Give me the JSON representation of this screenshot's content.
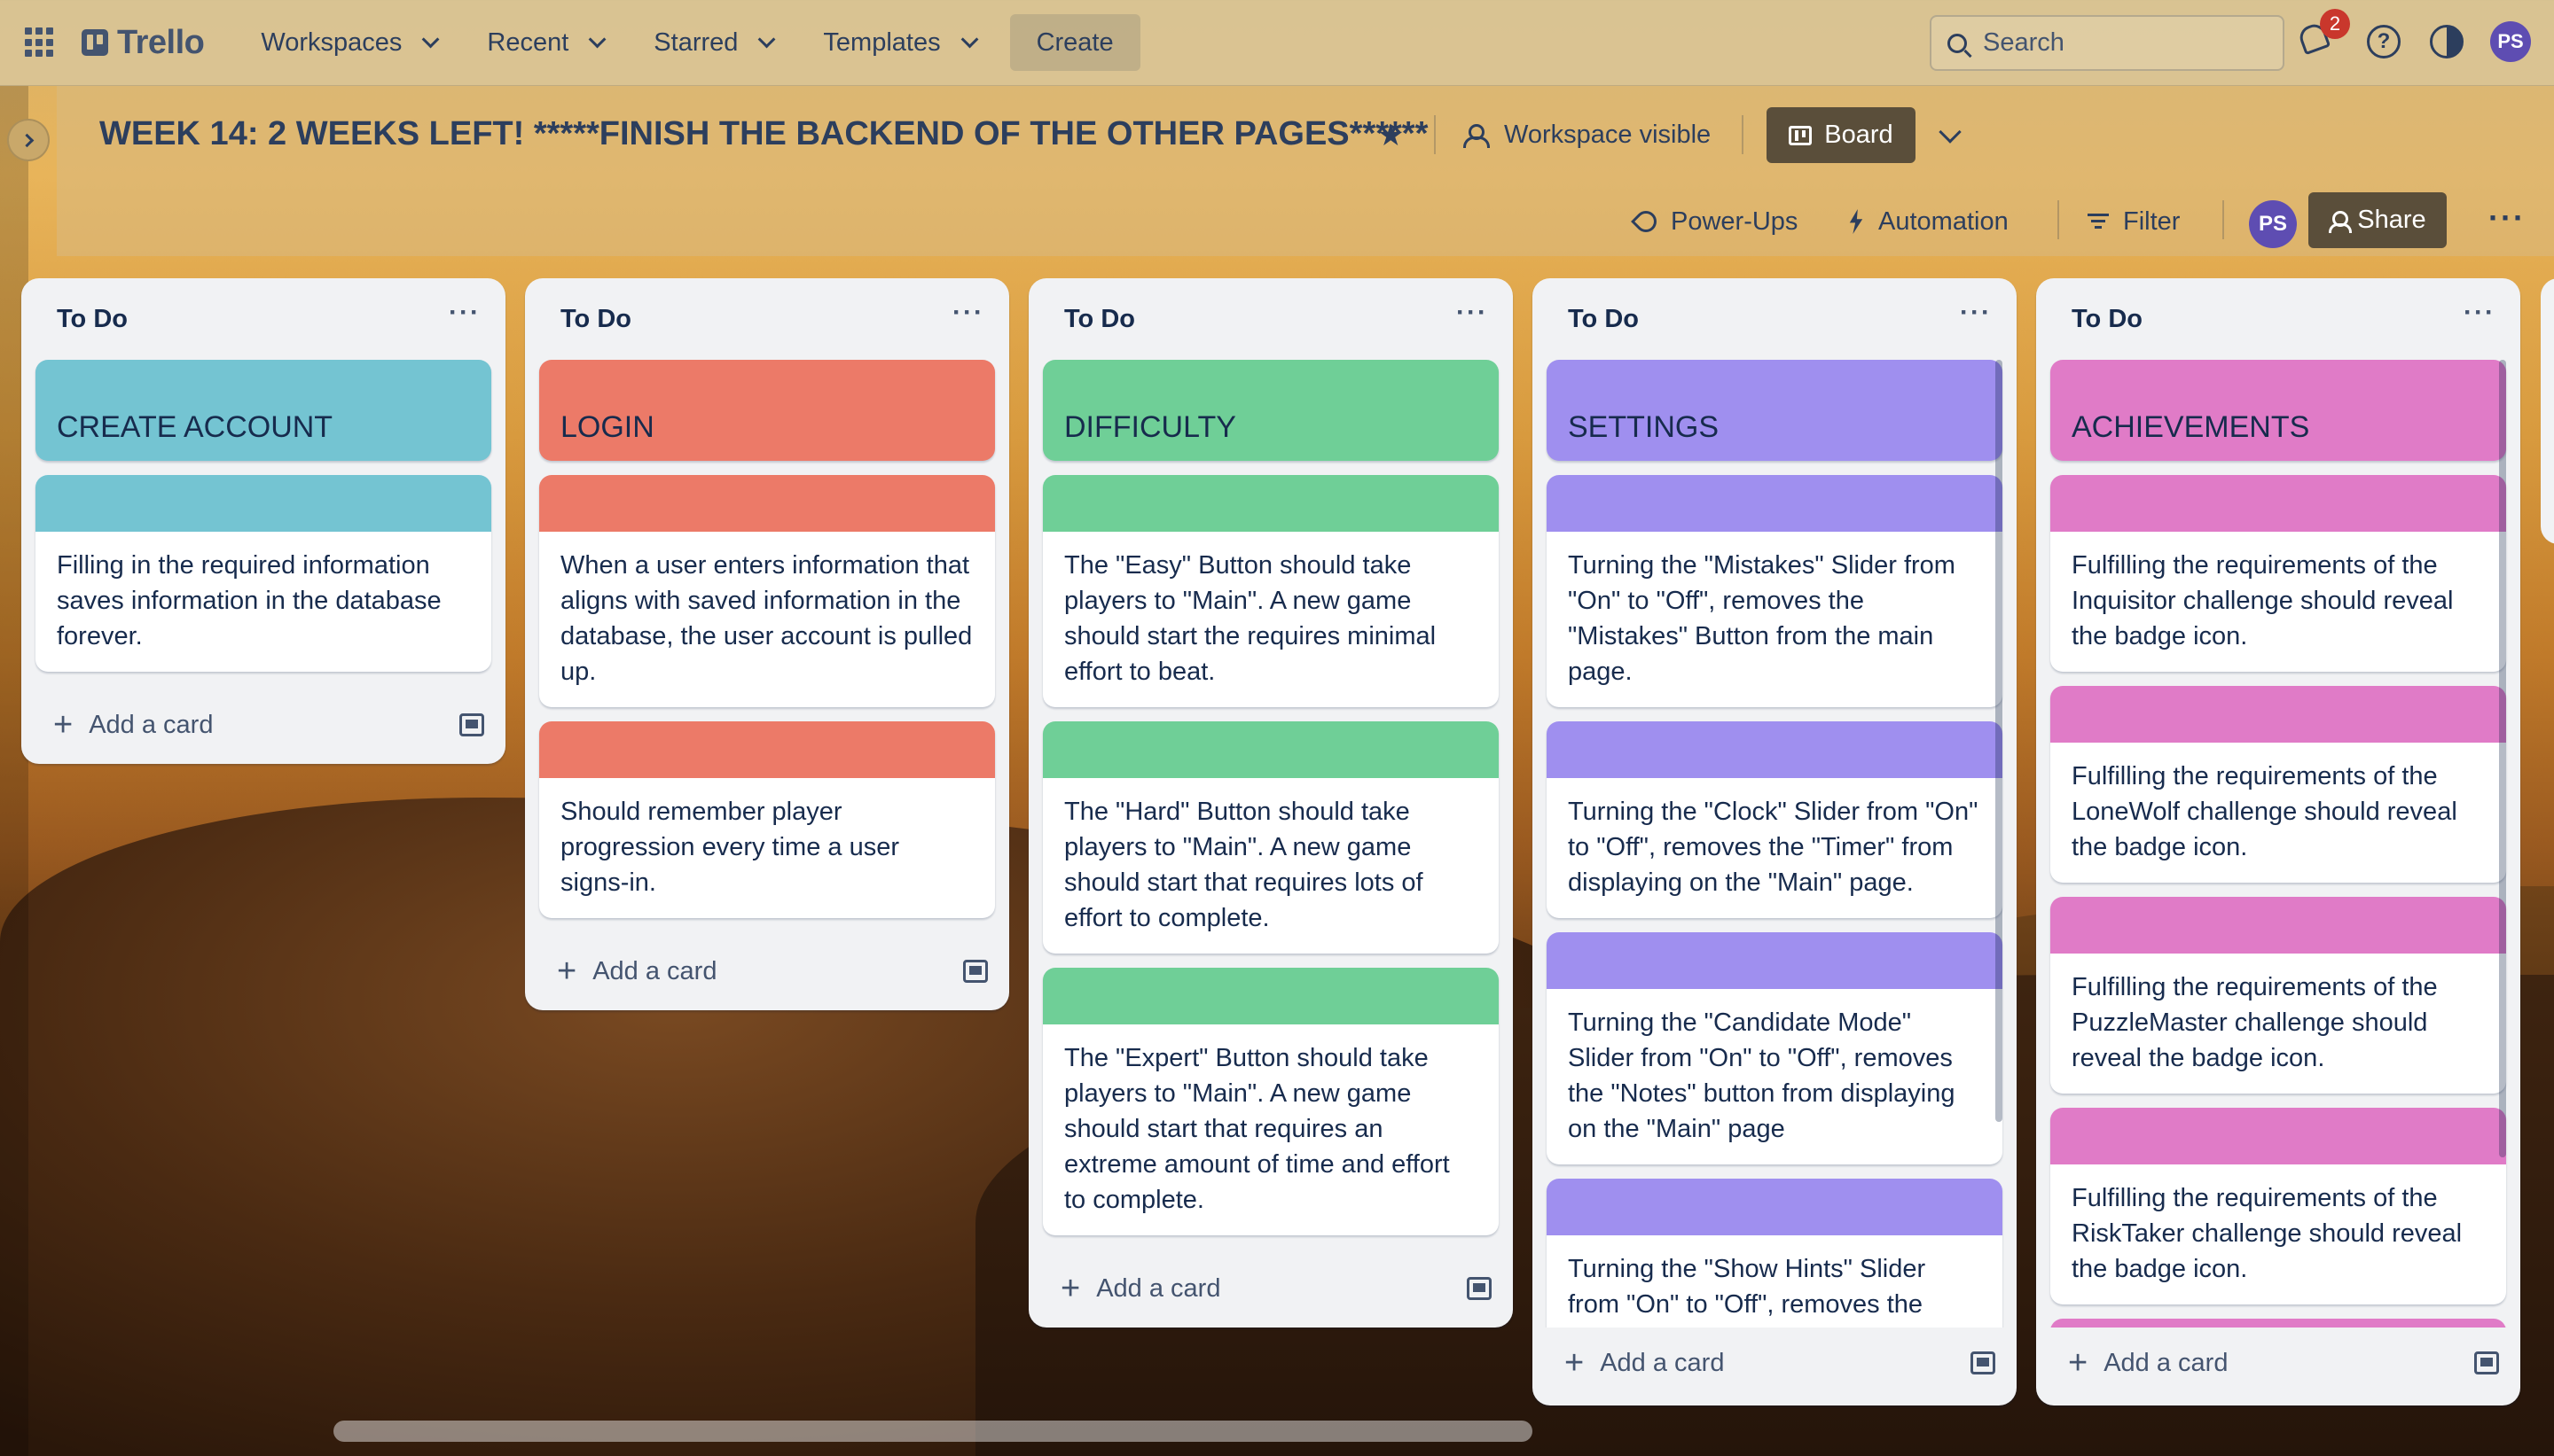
{
  "nav": {
    "logo": "Trello",
    "menus": [
      "Workspaces",
      "Recent",
      "Starred",
      "Templates"
    ],
    "create": "Create",
    "search_placeholder": "Search",
    "notifications": "2",
    "user_initials": "PS"
  },
  "board": {
    "title": "WEEK 14: 2 WEEKS LEFT! *****FINISH THE BACKEND OF THE OTHER PAGES******",
    "visibility": "Workspace visible",
    "view": "Board",
    "powerups": "Power-Ups",
    "automation": "Automation",
    "filter": "Filter",
    "share": "Share",
    "member_initials": "PS"
  },
  "colors": {
    "teal": "#74c4d2",
    "red": "#ec7a68",
    "green": "#6fcf97",
    "purple": "#9f8fef",
    "pink": "#e07bc7"
  },
  "lists": [
    {
      "title": "To Do",
      "color": "#74c4d2",
      "heading": "CREATE ACCOUNT",
      "cards": [
        "Filling in the required information saves information in the database forever."
      ],
      "add": "Add a card"
    },
    {
      "title": "To Do",
      "color": "#ec7a68",
      "heading": "LOGIN",
      "cards": [
        "When a user enters information that aligns with saved information in the database, the user account is pulled up.",
        "Should remember player progression every time a user signs-in."
      ],
      "add": "Add a card"
    },
    {
      "title": "To Do",
      "color": "#6fcf97",
      "heading": "DIFFICULTY",
      "cards": [
        "The \"Easy\" Button should take players to \"Main\". A new game should start the requires minimal effort to beat.",
        "The \"Hard\" Button should take players to \"Main\". A new game should start that requires lots of effort to complete.",
        "The \"Expert\" Button should take players to \"Main\". A new game should start that requires an extreme amount of time and effort to complete."
      ],
      "add": "Add a card"
    },
    {
      "title": "To Do",
      "color": "#9f8fef",
      "heading": "SETTINGS",
      "cards": [
        "Turning the \"Mistakes\" Slider from \"On\" to \"Off\", removes the \"Mistakes\" Button from the main page.",
        "Turning the \"Clock\" Slider from \"On\" to \"Off\", removes the \"Timer\" from displaying on the \"Main\" page.",
        "Turning the \"Candidate Mode\" Slider from \"On\" to \"Off\", removes the \"Notes\" button from displaying on the \"Main\" page",
        "Turning the \"Show Hints\" Slider from \"On\" to \"Off\", removes the"
      ],
      "add": "Add a card"
    },
    {
      "title": "To Do",
      "color": "#e07bc7",
      "heading": "ACHIEVEMENTS",
      "cards": [
        "Fulfilling the requirements of the Inquisitor challenge should reveal the badge icon.",
        "Fulfilling the requirements of the LoneWolf challenge should reveal the badge icon.",
        "Fulfilling the requirements of the PuzzleMaster challenge should reveal the badge icon.",
        "Fulfilling the requirements of the RiskTaker challenge should reveal the badge icon.",
        ""
      ],
      "add": "Add a card"
    }
  ]
}
